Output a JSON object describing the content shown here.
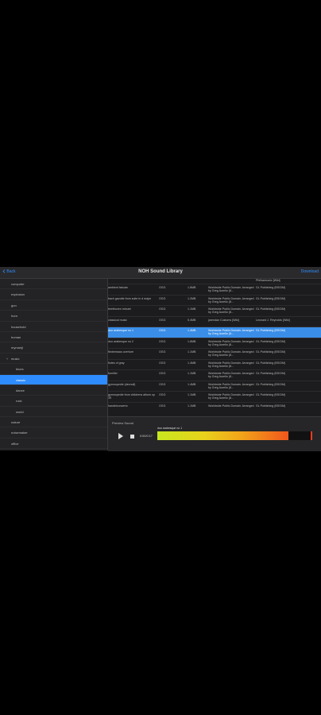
{
  "navbar": {
    "back_label": "Back",
    "title": "NOH Sound Library",
    "action_label": "Download"
  },
  "sidebar": {
    "items": [
      {
        "label": "computer",
        "level": 0
      },
      {
        "label": "explosion",
        "level": 0
      },
      {
        "label": "gun",
        "level": 0
      },
      {
        "label": "horn",
        "level": 0
      },
      {
        "label": "household",
        "level": 0
      },
      {
        "label": "human",
        "level": 0
      },
      {
        "label": "mymanji",
        "level": 0
      },
      {
        "label": "music",
        "level": 0,
        "expanded": true
      },
      {
        "label": "blues",
        "level": 1
      },
      {
        "label": "classic",
        "level": 1,
        "selected": true
      },
      {
        "label": "dance",
        "level": 1
      },
      {
        "label": "rock",
        "level": 1
      },
      {
        "label": "world",
        "level": 1
      },
      {
        "label": "nature",
        "level": 0
      },
      {
        "label": "noisemaker",
        "level": 0
      },
      {
        "label": "office",
        "level": 0
      }
    ]
  },
  "table": {
    "rows": [
      {
        "name": "",
        "format": "",
        "size": "",
        "license": "",
        "publisher": "Philharmonic [Wiki]"
      },
      {
        "name": "ambient fabular",
        "format": "OGG",
        "size": "1.6MB",
        "license": "Worldwide Public Domain. Arranged by Greg Aurelio (8...",
        "publisher": "GL Publishing (BSG/M)"
      },
      {
        "name": "bach gavotte from suite in d major",
        "format": "OGG",
        "size": "1.2MB",
        "license": "Worldwide Public Domain. Arranged by Greg Aurelio (8...",
        "publisher": "GL Publishing (BSG/M)"
      },
      {
        "name": "beethoven minuet",
        "format": "OGG",
        "size": "1.1MB",
        "license": "Worldwide Public Domain. Arranged by Greg Aurelio (8...",
        "publisher": "GL Publishing (BSG/M)"
      },
      {
        "name": "classical music",
        "format": "OGG",
        "size": "5.4MB",
        "license": "jarendan Customs [Wiki]",
        "publisher": "Leonard J. Reynolds [Wiki]"
      },
      {
        "name": "duo arabesque no 1",
        "format": "OGG",
        "size": "1.4MB",
        "license": "Worldwide Public Domain. Arranged by Greg Aurelio (8...",
        "publisher": "GL Publishing (BSG/M)",
        "selected": true
      },
      {
        "name": "duo arabesque no 2",
        "format": "OGG",
        "size": "1.6MB",
        "license": "Worldwide Public Domain. Arranged by Greg Aurelio (8...",
        "publisher": "GL Publishing (BSG/M)"
      },
      {
        "name": "fledermaus overture",
        "format": "OGG",
        "size": "1.1MB",
        "license": "Worldwide Public Domain. Arranged by Greg Aurelio (8...",
        "publisher": "GL Publishing (BSG/M)"
      },
      {
        "name": "flutes of gray",
        "format": "OGG",
        "size": "1.4MB",
        "license": "Worldwide Public Domain. Arranged by Greg Aurelio (8...",
        "publisher": "GL Publishing (BSG/M)"
      },
      {
        "name": "furnilier",
        "format": "OGG",
        "size": "1.1MB",
        "license": "Worldwide Public Domain. Arranged by Greg Aurelio (8...",
        "publisher": "GL Publishing (BSG/M)"
      },
      {
        "name": "gymnopedie (devnull)",
        "format": "OGG",
        "size": "1.4MB",
        "license": "Worldwide Public Domain. Arranged by Greg Aurelio (8...",
        "publisher": "GL Publishing (BSG/M)"
      },
      {
        "name": "gymnopedie from childrens album op 39",
        "format": "OGG",
        "size": "1.1MB",
        "license": "Worldwide Public Domain. Arranged by Greg Aurelio (8...",
        "publisher": "GL Publishing (BSG/M)"
      },
      {
        "name": "handelconcerto",
        "format": "OGG",
        "size": "1.1MB",
        "license": "Worldwide Public Domain. Arranged by Greg Aurelio (8...",
        "publisher": "GL Publishing (BSG/M)"
      }
    ]
  },
  "preview": {
    "label": "Preview Sound",
    "time": "0:00/0:17",
    "filename": "duo arabesque no 1"
  }
}
